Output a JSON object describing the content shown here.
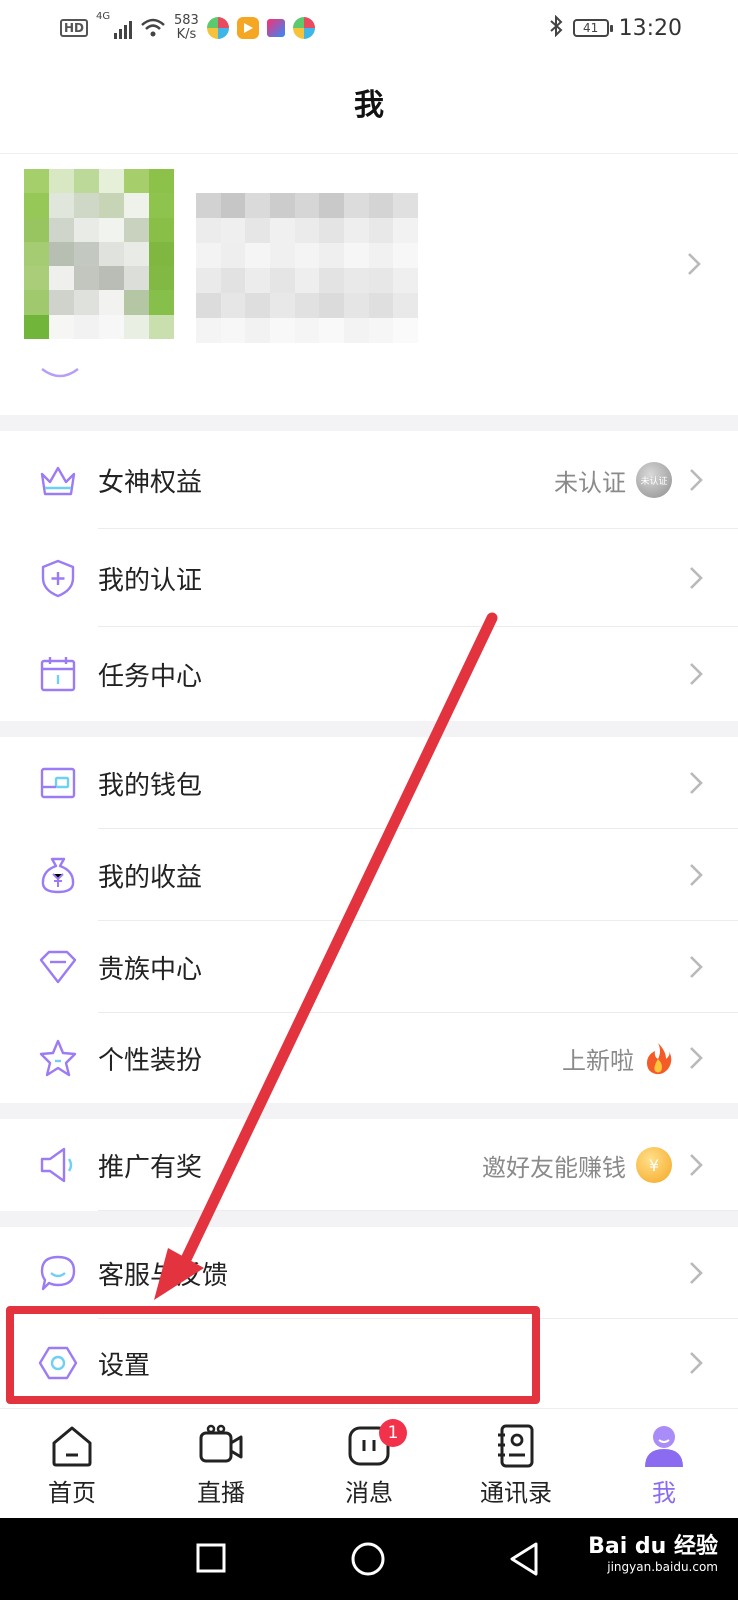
{
  "status_bar": {
    "hd": "HD",
    "network": "4G",
    "speed_value": "583",
    "speed_unit": "K/s",
    "battery": "41",
    "time": "13:20",
    "app_icons": [
      "app-icon-1",
      "play-icon",
      "youku-icon",
      "app-icon-2"
    ]
  },
  "header": {
    "title": "我"
  },
  "menu": {
    "goddess": {
      "label": "女神权益",
      "right_text": "未认证",
      "badge_text": "未认证"
    },
    "verify": {
      "label": "我的认证"
    },
    "tasks": {
      "label": "任务中心"
    },
    "wallet": {
      "label": "我的钱包"
    },
    "earnings": {
      "label": "我的收益"
    },
    "noble": {
      "label": "贵族中心"
    },
    "dress": {
      "label": "个性装扮",
      "right_text": "上新啦"
    },
    "promo": {
      "label": "推广有奖",
      "right_text": "邀好友能赚钱",
      "coin": "¥"
    },
    "service": {
      "label": "客服与反馈"
    },
    "settings": {
      "label": "设置"
    }
  },
  "tabbar": {
    "tabs": [
      {
        "label": "首页",
        "icon": "home-icon"
      },
      {
        "label": "直播",
        "icon": "camera-icon"
      },
      {
        "label": "消息",
        "icon": "message-icon",
        "badge": "1"
      },
      {
        "label": "通讯录",
        "icon": "contacts-icon"
      },
      {
        "label": "我",
        "icon": "profile-icon",
        "active": true
      }
    ]
  },
  "watermark": {
    "brand": "Bai du 经验",
    "url": "jingyan.baidu.com"
  },
  "colors": {
    "accent": "#8b6cf0",
    "highlight": "#e2333f",
    "icon_line": "#9b7cf4"
  }
}
